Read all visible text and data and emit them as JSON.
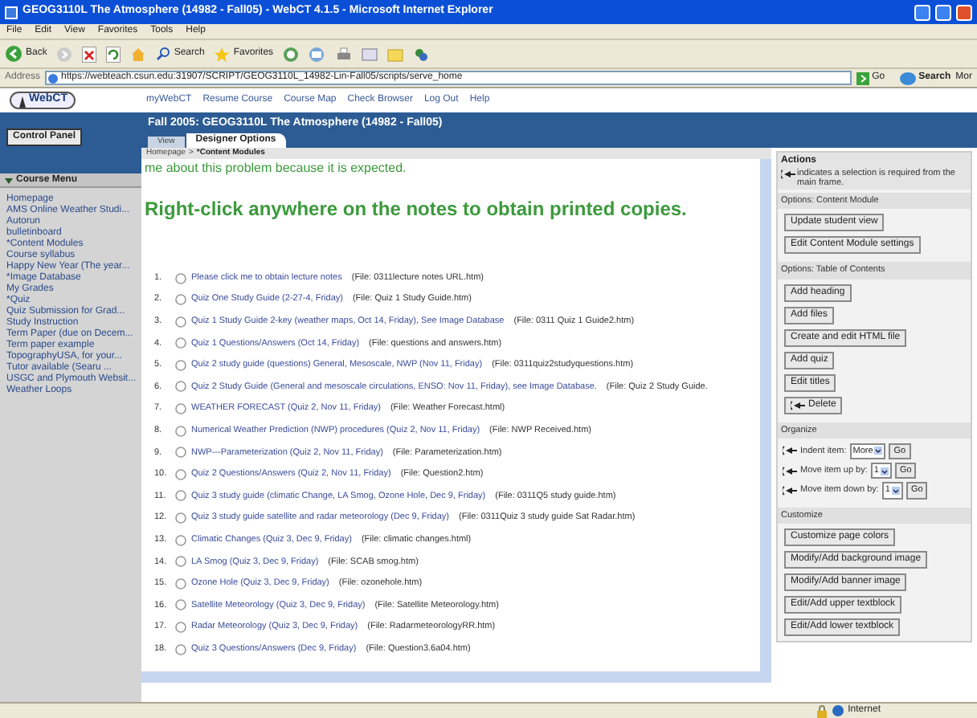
{
  "window": {
    "title": "GEOG3110L The Atmosphere (14982 - Fall05) - WebCT 4.1.5 - Microsoft Internet Explorer"
  },
  "menu_bar": [
    "File",
    "Edit",
    "View",
    "Favorites",
    "Tools",
    "Help"
  ],
  "toolbar": {
    "back": "Back",
    "search": "Search",
    "favorites": "Favorites"
  },
  "address_bar": {
    "label": "Address",
    "value": "https://webteach.csun.edu:31907/SCRIPT/GEOG3110L_14982-Lin-Fall05/scripts/serve_home",
    "go": "Go",
    "search": "Search",
    "more": "Mor"
  },
  "webct": {
    "logo": "WebCT",
    "links": [
      "myWebCT",
      "Resume Course",
      "Course Map",
      "Check Browser",
      "Log Out",
      "Help"
    ],
    "course_title": "Fall 2005: GEOG3110L The Atmosphere (14982 - Fall05)"
  },
  "tabs": [
    {
      "label": "View",
      "selected": false
    },
    {
      "label": "Designer Options",
      "selected": true
    }
  ],
  "breadcrumb": {
    "home": "Homepage",
    "separator": ">",
    "current": "*Content Modules"
  },
  "sidebar": {
    "control_panel": "Control Panel",
    "menu_title": "Course Menu",
    "expanded": true,
    "items": [
      "Homepage",
      "AMS Online Weather Studi...",
      "Autorun",
      "bulletinboard",
      "*Content Modules",
      "Course syllabus",
      "Happy New Year (The year...",
      "*Image Database",
      "My Grades",
      "*Quiz",
      "Quiz Submission for Grad...",
      "Study Instruction",
      "Term Paper (due on Decem...",
      "Term paper example",
      "TopographyUSA, for your...",
      "Tutor available (Searu ...",
      "USGC and Plymouth Websit...",
      "Weather Loops"
    ]
  },
  "content": {
    "intro": "me about this problem because it is expected.",
    "heading": "Right-click anywhere on the notes to obtain printed copies.",
    "items": [
      {
        "number": "1.",
        "title": "Please click me to obtain lecture notes",
        "file": "(File: 0311lecture notes URL.htm)",
        "selected": false
      },
      {
        "number": "2.",
        "title": "Quiz One Study Guide (2-27-4, Friday)",
        "file": "(File: Quiz 1 Study Guide.htm)",
        "selected": false
      },
      {
        "number": "3.",
        "title": "Quiz 1 Study Guide 2-key (weather maps, Oct 14, Friday), See Image Database",
        "file": "(File: 0311 Quiz 1 Guide2.htm)",
        "selected": false
      },
      {
        "number": "4.",
        "title": "Quiz 1 Questions/Answers (Oct 14, Friday)",
        "file": "(File: questions and answers.htm)",
        "selected": false
      },
      {
        "number": "5.",
        "title": "Quiz 2 study guide (questions) General, Mesoscale, NWP (Nov 11, Friday)",
        "file": "(File: 0311quiz2studyquestions.htm)",
        "selected": false
      },
      {
        "number": "6.",
        "title": "Quiz 2 Study Guide (General and mesoscale circulations, ENSO: Nov 11, Friday), see Image Database.",
        "file": "(File: Quiz 2 Study Guide.",
        "selected": false
      },
      {
        "number": "7.",
        "title": "WEATHER FORECAST (Quiz 2, Nov 11, Friday)",
        "file": "(File: Weather Forecast.html)",
        "selected": false
      },
      {
        "number": "8.",
        "title": "Numerical Weather Prediction (NWP) procedures (Quiz 2, Nov 11, Friday)",
        "file": "(File: NWP Received.htm)",
        "selected": false
      },
      {
        "number": "9.",
        "title": "NWP---Parameterization (Quiz 2, Nov 11, Friday)",
        "file": "(File: Parameterization.htm)",
        "selected": false
      },
      {
        "number": "10.",
        "title": "Quiz 2 Questions/Answers (Quiz 2, Nov 11, Friday)",
        "file": "(File: Question2.htm)",
        "selected": false
      },
      {
        "number": "11.",
        "title": "Quiz 3 study guide (climatic Change, LA Smog, Ozone Hole, Dec 9, Friday)",
        "file": "(File: 0311Q5 study guide.htm)",
        "selected": false
      },
      {
        "number": "12.",
        "title": "Quiz 3 study guide satellite and radar meteorology (Dec 9, Friday)",
        "file": "(File: 0311Quiz 3 study guide Sat Radar.htm)",
        "selected": false
      },
      {
        "number": "13.",
        "title": "Climatic Changes (Quiz 3, Dec 9, Friday)",
        "file": "(File: climatic changes.html)",
        "selected": false
      },
      {
        "number": "14.",
        "title": "LA Smog (Quiz 3, Dec 9, Friday)",
        "file": "(File: SCAB smog.htm)",
        "selected": false
      },
      {
        "number": "15.",
        "title": "Ozone Hole (Quiz 3, Dec 9, Friday)",
        "file": "(File: ozonehole.htm)",
        "selected": false
      },
      {
        "number": "16.",
        "title": "Satellite Meteorology (Quiz 3, Dec 9, Friday)",
        "file": "(File: Satellite Meteorology.htm)",
        "selected": false
      },
      {
        "number": "17.",
        "title": "Radar Meteorology (Quiz 3, Dec 9, Friday)",
        "file": "(File: RadarmeteorologyRR.htm)",
        "selected": false
      },
      {
        "number": "18.",
        "title": "Quiz 3 Questions/Answers (Dec 9, Friday)",
        "file": "(File: Question3.6a04.htm)",
        "selected": false
      }
    ]
  },
  "actions": {
    "title": "Actions",
    "note": "indicates a selection is required from the main frame.",
    "sections": [
      {
        "title": "Options: Content Module",
        "buttons": [
          {
            "label": "Update student view",
            "needs_selection": false
          },
          {
            "label": "Edit Content Module settings",
            "needs_selection": false
          }
        ]
      },
      {
        "title": "Options: Table of Contents",
        "buttons": [
          {
            "label": "Add heading",
            "needs_selection": false
          },
          {
            "label": "Add files",
            "needs_selection": false
          },
          {
            "label": "Create and edit HTML file",
            "needs_selection": false
          },
          {
            "label": "Add quiz",
            "needs_selection": false
          },
          {
            "label": "Edit titles",
            "needs_selection": false
          },
          {
            "label": "Delete",
            "needs_selection": true
          }
        ]
      }
    ],
    "organize": {
      "title": "Organize",
      "rows": [
        {
          "label": "Indent item:",
          "value": "More",
          "go": "Go"
        },
        {
          "label": "Move item up by:",
          "value": "1",
          "go": "Go"
        },
        {
          "label": "Move item down by:",
          "value": "1",
          "go": "Go"
        }
      ]
    },
    "customize": {
      "title": "Customize",
      "buttons": [
        "Customize page colors",
        "Modify/Add background image",
        "Modify/Add banner image",
        "Edit/Add upper textblock",
        "Edit/Add lower textblock"
      ]
    }
  },
  "status_bar": {
    "zone": "Internet"
  }
}
